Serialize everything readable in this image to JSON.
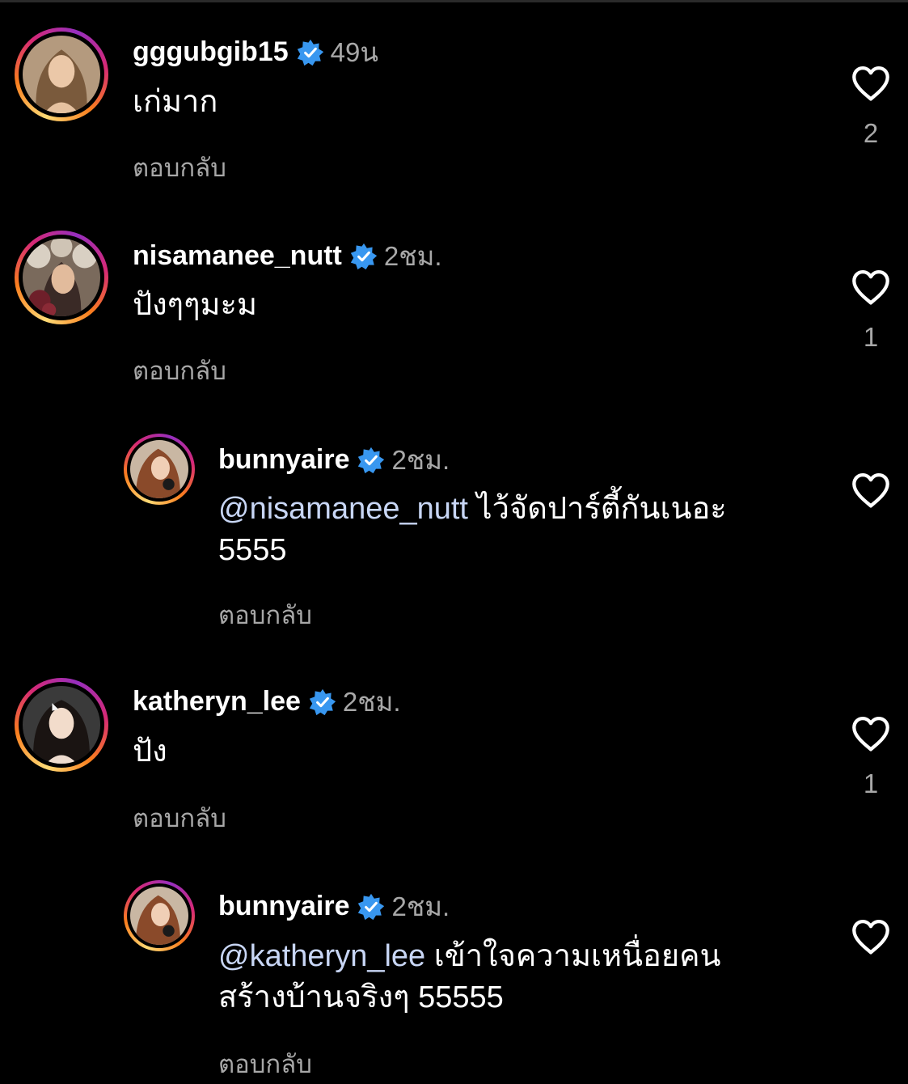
{
  "colors": {
    "background": "#000000",
    "username": "#ffffff",
    "secondary_text": "#a8a8a8",
    "verified_badge": "#3897f0",
    "story_ring": [
      "#feda75",
      "#fa7e1e",
      "#d62976",
      "#962fbf"
    ]
  },
  "icons": {
    "verified": "verified-badge-icon",
    "like": "heart-outline-icon"
  },
  "comments": [
    {
      "username": "gggubgib15",
      "verified": true,
      "time": "49น",
      "text": "เก่มาก",
      "reply_label": "ตอบกลับ",
      "likes": "2"
    },
    {
      "username": "nisamanee_nutt",
      "verified": true,
      "time": "2ชม.",
      "text": "ปังๆๆมะม",
      "reply_label": "ตอบกลับ",
      "likes": "1"
    },
    {
      "username": "bunnyaire",
      "verified": true,
      "time": "2ชม.",
      "mention": "@nisamanee_nutt",
      "text_line1": " ไว้จัดปาร์ตี้กันเนอะ",
      "text_line2": "5555",
      "reply_label": "ตอบกลับ",
      "likes": ""
    },
    {
      "username": "katheryn_lee",
      "verified": true,
      "time": "2ชม.",
      "text": "ปัง",
      "reply_label": "ตอบกลับ",
      "likes": "1"
    },
    {
      "username": "bunnyaire",
      "verified": true,
      "time": "2ชม.",
      "mention": "@katheryn_lee",
      "text_line1": " เข้าใจความเหนื่อยคน",
      "text_line2": "สร้างบ้านจริงๆ 55555",
      "reply_label": "ตอบกลับ",
      "likes": ""
    }
  ]
}
